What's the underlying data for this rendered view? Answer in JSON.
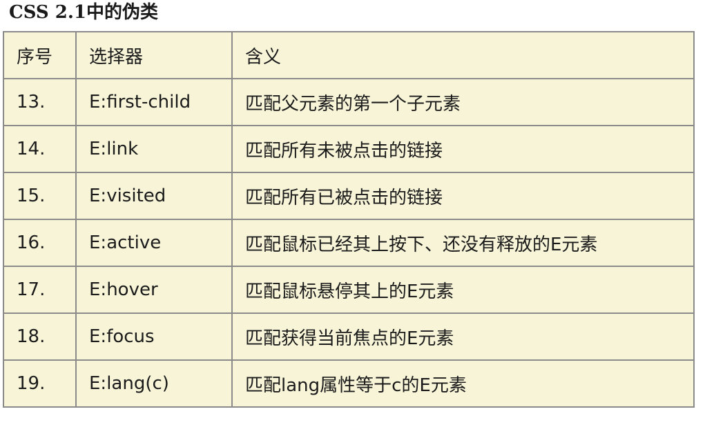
{
  "heading": "CSS 2.1中的伪类",
  "table": {
    "headers": [
      "序号",
      "选择器",
      "含义"
    ],
    "rows": [
      {
        "num": "13.",
        "selector": "E:first-child",
        "meaning": "匹配父元素的第一个子元素"
      },
      {
        "num": "14.",
        "selector": "E:link",
        "meaning": "匹配所有未被点击的链接"
      },
      {
        "num": "15.",
        "selector": "E:visited",
        "meaning": "匹配所有已被点击的链接"
      },
      {
        "num": "16.",
        "selector": "E:active",
        "meaning": "匹配鼠标已经其上按下、还没有释放的E元素"
      },
      {
        "num": "17.",
        "selector": "E:hover",
        "meaning": "匹配鼠标悬停其上的E元素"
      },
      {
        "num": "18.",
        "selector": "E:focus",
        "meaning": "匹配获得当前焦点的E元素"
      },
      {
        "num": "19.",
        "selector": "E:lang(c)",
        "meaning": "匹配lang属性等于c的E元素"
      }
    ]
  }
}
